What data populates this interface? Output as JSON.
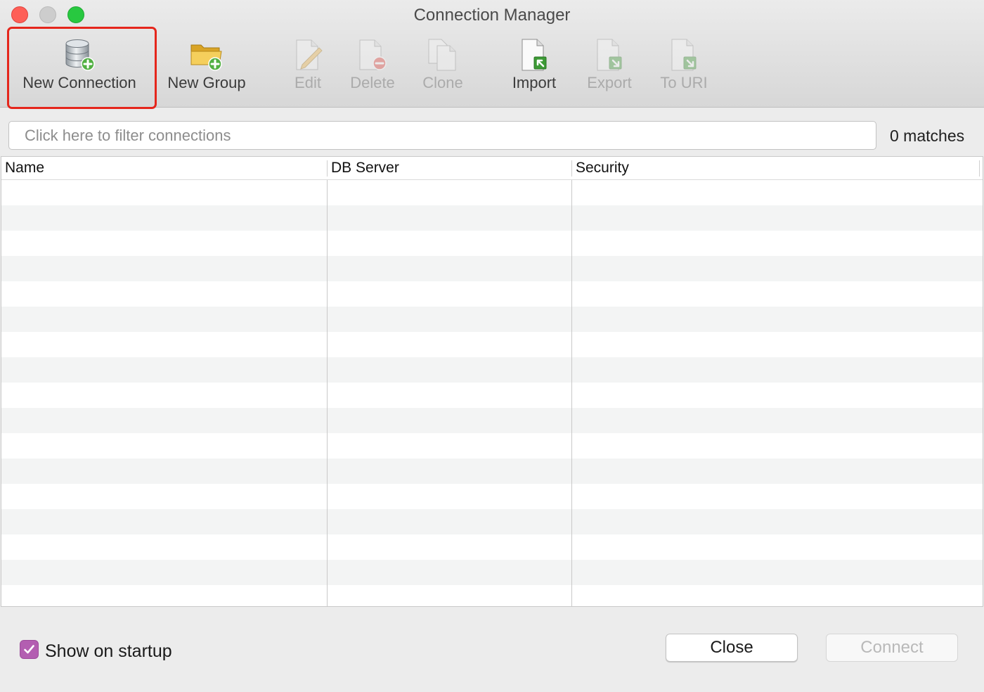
{
  "window": {
    "title": "Connection Manager"
  },
  "toolbar": {
    "items": [
      {
        "label": "New Connection",
        "icon": "database-add-icon",
        "enabled": true,
        "highlighted": true
      },
      {
        "label": "New Group",
        "icon": "folder-add-icon",
        "enabled": true
      },
      {
        "label": "Edit",
        "icon": "edit-icon",
        "enabled": false
      },
      {
        "label": "Delete",
        "icon": "delete-icon",
        "enabled": false
      },
      {
        "label": "Clone",
        "icon": "clone-icon",
        "enabled": false
      },
      {
        "label": "Import",
        "icon": "import-icon",
        "enabled": true
      },
      {
        "label": "Export",
        "icon": "export-icon",
        "enabled": false
      },
      {
        "label": "To URI",
        "icon": "to-uri-icon",
        "enabled": false
      }
    ]
  },
  "filter": {
    "placeholder": "Click here to filter connections",
    "value": "",
    "matches": "0 matches"
  },
  "table": {
    "columns": [
      "Name",
      "DB Server",
      "Security"
    ],
    "rows": []
  },
  "footer": {
    "show_on_startup": {
      "label": "Show on startup",
      "checked": true
    },
    "close_label": "Close",
    "connect_label": "Connect",
    "connect_enabled": false
  },
  "colors": {
    "accent": "#b35eb1",
    "highlight": "#e5261c"
  }
}
